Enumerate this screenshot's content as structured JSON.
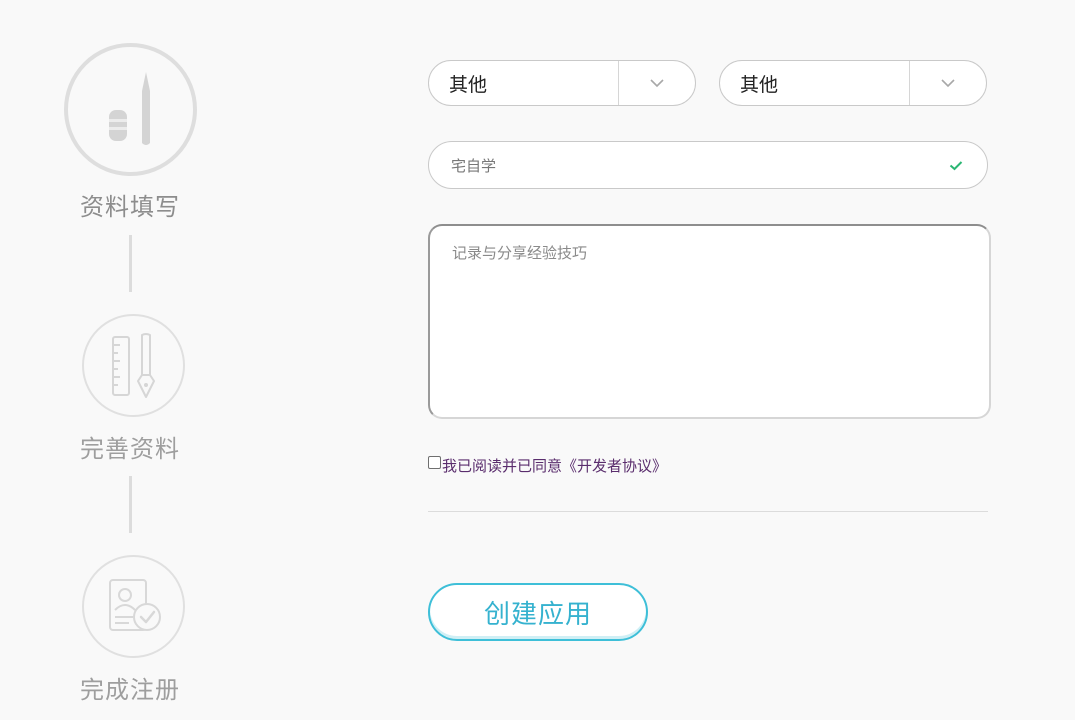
{
  "steps": [
    {
      "label": "资料填写",
      "icon": "pen-eraser-icon"
    },
    {
      "label": "完善资料",
      "icon": "ruler-pen-icon"
    },
    {
      "label": "完成注册",
      "icon": "profile-check-icon"
    }
  ],
  "form": {
    "select_1": {
      "value": "其他"
    },
    "select_2": {
      "value": "其他"
    },
    "name_field": {
      "value": "宅自学",
      "status_icon": "check-icon"
    },
    "description": {
      "placeholder": "记录与分享经验技巧"
    },
    "agreement": {
      "label": "我已阅读并已同意《开发者协议》"
    },
    "submit_label": "创建应用"
  },
  "colors": {
    "accent": "#3ebfd8",
    "check": "#2bb673",
    "agreement_text": "#5a2d6d",
    "step_icon": "#d6d6d6"
  }
}
